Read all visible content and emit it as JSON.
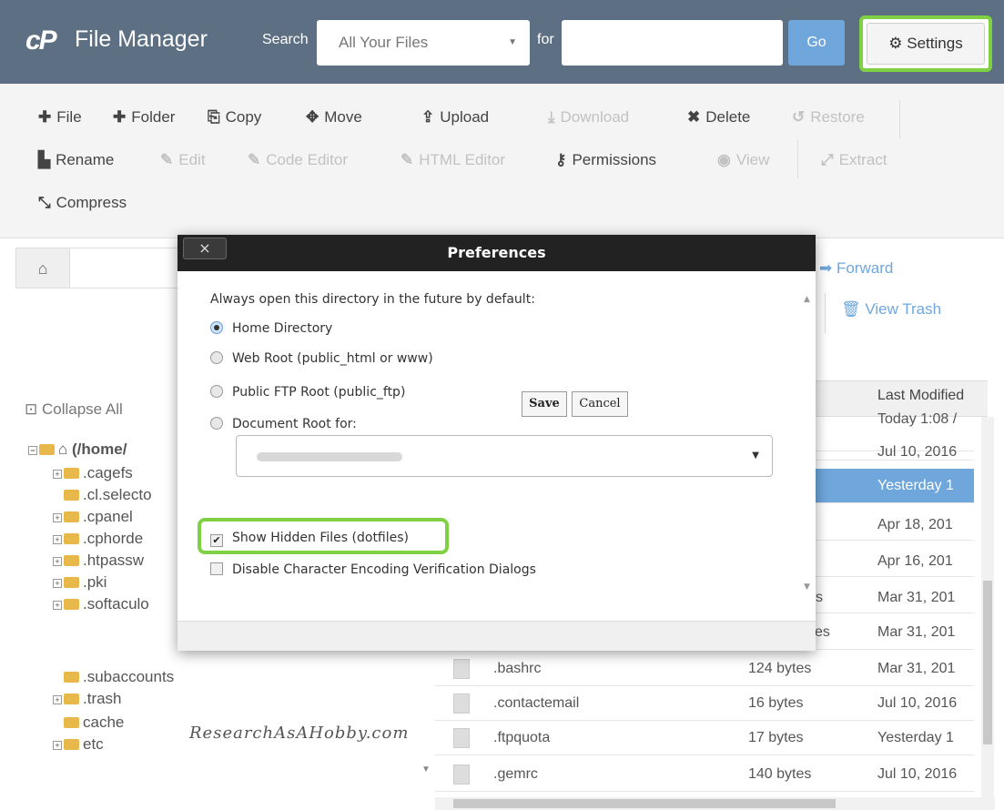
{
  "header": {
    "logo": "cP",
    "title": "File Manager",
    "search_label": "Search",
    "search_scope": "All Your Files",
    "for_label": "for",
    "search_value": "",
    "go_label": "Go",
    "settings_label": "Settings"
  },
  "toolbar": {
    "row1": [
      {
        "icon": "plus-icon",
        "glyph": "✚",
        "label": "File",
        "enabled": true
      },
      {
        "icon": "plus-icon",
        "glyph": "✚",
        "label": "Folder",
        "enabled": true
      },
      {
        "icon": "copy-icon",
        "glyph": "⎘",
        "label": "Copy",
        "enabled": true
      },
      {
        "icon": "move-icon",
        "glyph": "✥",
        "label": "Move",
        "enabled": true
      },
      {
        "icon": "upload-icon",
        "glyph": "⇪",
        "label": "Upload",
        "enabled": true
      },
      {
        "icon": "download-icon",
        "glyph": "⤓",
        "label": "Download",
        "enabled": false
      },
      {
        "icon": "close-icon",
        "glyph": "✖",
        "label": "Delete",
        "enabled": true
      },
      {
        "icon": "undo-icon",
        "glyph": "↺",
        "label": "Restore",
        "enabled": false
      }
    ],
    "row2": [
      {
        "icon": "file-icon",
        "glyph": "▙",
        "label": "Rename",
        "enabled": true
      },
      {
        "icon": "pencil-icon",
        "glyph": "✎",
        "label": "Edit",
        "enabled": false
      },
      {
        "icon": "edit-icon",
        "glyph": "✎",
        "label": "Code Editor",
        "enabled": false
      },
      {
        "icon": "edit-icon",
        "glyph": "✎",
        "label": "HTML Editor",
        "enabled": false
      },
      {
        "icon": "key-icon",
        "glyph": "⚷",
        "label": "Permissions",
        "enabled": true
      },
      {
        "icon": "eye-icon",
        "glyph": "◉",
        "label": "View",
        "enabled": false
      },
      {
        "icon": "expand-icon",
        "glyph": "⤢",
        "label": "Extract",
        "enabled": false
      }
    ],
    "row3": [
      {
        "icon": "compress-icon",
        "glyph": "⤡",
        "label": "Compress",
        "enabled": true
      }
    ]
  },
  "nav": {
    "forward_label": "Forward",
    "view_trash_label": "View Trash"
  },
  "tree": {
    "collapse_all": "Collapse All",
    "root": "(/home/",
    "items": [
      ".cagefs",
      ".cl.selecto",
      ".cpanel",
      ".cphorde",
      ".htpassw",
      ".pki",
      ".softaculo",
      ".subaccounts",
      ".trash",
      "cache",
      "etc"
    ]
  },
  "watermark": "ResearchAsAHobby.com",
  "file_list": {
    "columns": {
      "last_modified": "Last Modified"
    },
    "partial_dates": [
      "Today 1:08 /",
      "Jul 10, 2016",
      "Yesterday 1",
      "Apr 18, 201",
      "Apr 16, 201",
      "Mar 31, 201",
      "Mar 31, 201"
    ],
    "partial_size_fragments": [
      "s",
      "es"
    ],
    "rows": [
      {
        "name": ".bashrc",
        "size": "124 bytes",
        "date": "Mar 31, 201"
      },
      {
        "name": ".contactemail",
        "size": "16 bytes",
        "date": "Jul 10, 2016"
      },
      {
        "name": ".ftpquota",
        "size": "17 bytes",
        "date": "Yesterday 1"
      },
      {
        "name": ".gemrc",
        "size": "140 bytes",
        "date": "Jul 10, 2016"
      }
    ]
  },
  "modal": {
    "title": "Preferences",
    "close_label": "×",
    "prompt": "Always open this directory in the future by default:",
    "options": [
      {
        "label": "Home Directory",
        "checked": true
      },
      {
        "label": "Web Root (public_html or www)",
        "checked": false
      },
      {
        "label": "Public FTP Root (public_ftp)",
        "checked": false
      },
      {
        "label": "Document Root for:",
        "checked": false
      }
    ],
    "docroot_value": "",
    "show_hidden_label": "Show Hidden Files (dotfiles)",
    "show_hidden_checked": true,
    "disable_encoding_label": "Disable Character Encoding Verification Dialogs",
    "disable_encoding_checked": false,
    "save_label": "Save",
    "cancel_label": "Cancel"
  },
  "colors": {
    "header_bg": "#5d6f82",
    "accent_blue": "#6fa7dc",
    "highlight_green": "#80d044",
    "modal_titlebar": "#222222"
  }
}
